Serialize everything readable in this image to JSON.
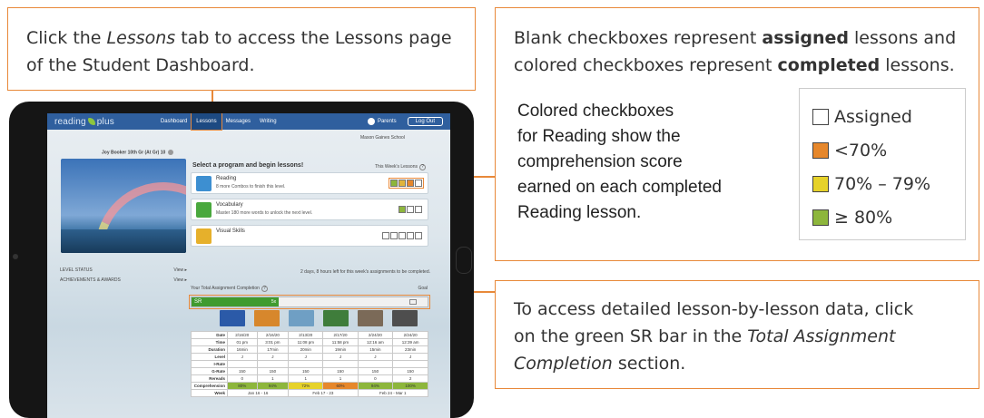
{
  "callouts": {
    "top_line1_a": "Click the ",
    "top_line1_em": "Lessons",
    "top_line1_b": " tab to access the Lessons page",
    "top_line2": "of the Student Dashboard.",
    "right_line1_a": "Blank checkboxes represent ",
    "right_line1_bold": "assigned",
    "right_line1_b": " lessons and",
    "right_line2_a": "colored checkboxes represent ",
    "right_line2_bold": "completed",
    "right_line2_b": " lessons.",
    "desc_lines": [
      "Colored checkboxes",
      "for Reading show the",
      "comprehension score",
      "earned on each completed",
      "Reading lesson."
    ],
    "bottom_line1": "To access detailed lesson-by-lesson data, click",
    "bottom_line2": "on the green SR bar in the ",
    "bottom_line2_em": "Total Assignment",
    "bottom_line3_em": "Completion",
    "bottom_line3": " section."
  },
  "legend": [
    {
      "label": "Assigned",
      "color": "#ffffff"
    },
    {
      "label": "<70%",
      "color": "#e6872b"
    },
    {
      "label": "70% – 79%",
      "color": "#e6d22a"
    },
    {
      "label": "≥ 80%",
      "color": "#8db63c"
    }
  ],
  "app": {
    "logo_left": "reading",
    "logo_right": "plus",
    "nav": [
      "Dashboard",
      "Lessons",
      "Messages",
      "Writing"
    ],
    "active_nav": "Lessons",
    "parents": "Parents",
    "logout": "Log Out",
    "school": "Mason Gaines School",
    "user": "Joy Booker 10th Gr (At Gr) 10",
    "select_title": "Select a program and begin lessons!",
    "week_lessons": "This Week's Lessons",
    "programs": [
      {
        "name": "Reading",
        "sub": "8 more Combos to finish this level.",
        "icon_color": "#3d8fd1"
      },
      {
        "name": "Vocabulary",
        "sub": "Master 180 more words to unlock the next level.",
        "icon_color": "#49a83d"
      },
      {
        "name": "Visual Skills",
        "sub": "",
        "icon_color": "#e6b02b"
      }
    ],
    "time_left": "2 days, 8 hours left for this week's assignments to be completed.",
    "level_status": "LEVEL STATUS",
    "achievements": "ACHIEVEMENTS & AWARDS",
    "view_more": "View ▸",
    "tac_title": "Your Total Assignment Completion",
    "goal": "Goal",
    "sr_label": "SR",
    "sr_value": "5x",
    "table": {
      "rows": [
        {
          "label": "Date",
          "cells": [
            "2/16/20",
            "2/16/20",
            "2/13/20",
            "2/17/20",
            "2/24/20",
            "2/24/20"
          ]
        },
        {
          "label": "Time",
          "cells": [
            "01 pm",
            "3:01 pm",
            "11:08 pm",
            "11:58 pm",
            "12:16 am",
            "12:39 am"
          ]
        },
        {
          "label": "Duration",
          "cells": [
            "16min",
            "17min",
            "20min",
            "19min",
            "15min",
            "23min"
          ]
        },
        {
          "label": "Level",
          "cells": [
            "J",
            "J",
            "J",
            "J",
            "J",
            "J"
          ]
        },
        {
          "label": "I-Rate",
          "cells": [
            "",
            "",
            "",
            "",
            "",
            ""
          ]
        },
        {
          "label": "G-Rate",
          "cells": [
            "150",
            "150",
            "150",
            "150",
            "150",
            "150"
          ]
        },
        {
          "label": "Rereads",
          "cells": [
            "0",
            "1",
            "1",
            "1",
            "0",
            "2"
          ]
        },
        {
          "label": "Comprehension",
          "cells": [
            "80%",
            "94%",
            "72%",
            "60%",
            "94%",
            "100%"
          ]
        }
      ],
      "weeks": [
        "Week",
        "Jan 16 - 16",
        "Feb 17 - 23",
        "Feb 24 - Mar 1"
      ]
    }
  }
}
